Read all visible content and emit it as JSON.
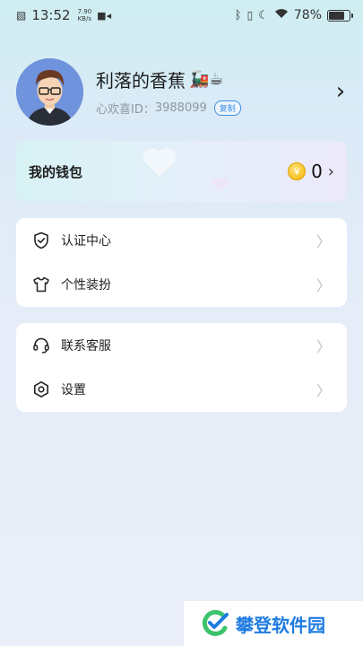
{
  "status_bar": {
    "time": "13:52",
    "speed_value": "7.90",
    "speed_unit": "KB/s",
    "battery": "78%"
  },
  "profile": {
    "nickname": "利落的香蕉",
    "emojis": "🚂☕",
    "id_label": "心欢喜ID：",
    "id_value": "3988099",
    "copy_label": "复制",
    "arrow": "›"
  },
  "wallet": {
    "title": "我的钱包",
    "coin_symbol": "¥",
    "amount": "0",
    "arrow": "›"
  },
  "menu_group_1": [
    {
      "label": "认证中心",
      "icon": "shield-check-icon"
    },
    {
      "label": "个性装扮",
      "icon": "tshirt-icon"
    }
  ],
  "menu_group_2": [
    {
      "label": "联系客服",
      "icon": "headset-icon"
    },
    {
      "label": "设置",
      "icon": "settings-hexagon-icon"
    }
  ],
  "watermark": {
    "text": "攀登软件园"
  },
  "colors": {
    "accent_blue": "#3f8ee8",
    "coin_gold": "#f4b400",
    "watermark_blue": "#1e7be0",
    "watermark_green": "#3cc36b"
  }
}
